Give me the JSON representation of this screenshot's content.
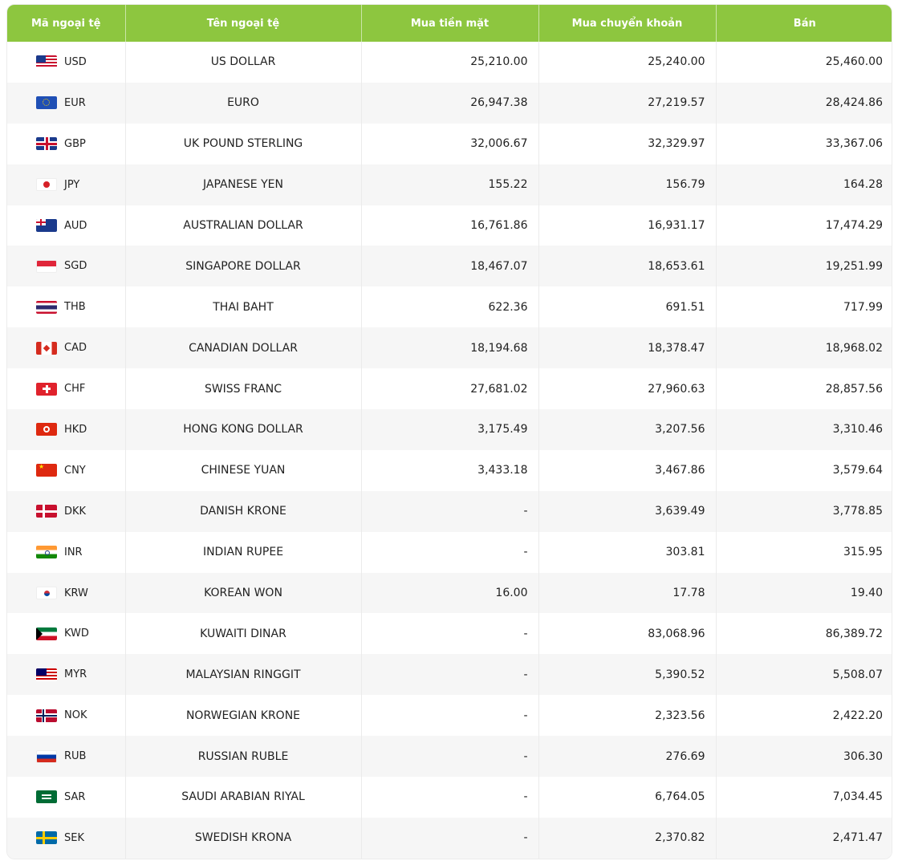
{
  "table": {
    "headers": {
      "code": "Mã ngoại tệ",
      "name": "Tên ngoại tệ",
      "cash_buy": "Mua tiền mặt",
      "transfer_buy": "Mua chuyển khoản",
      "sell": "Bán"
    },
    "rows": [
      {
        "flag": "us-flag-icon",
        "code": "USD",
        "name": "US DOLLAR",
        "cash_buy": "25,210.00",
        "transfer_buy": "25,240.00",
        "sell": "25,460.00"
      },
      {
        "flag": "eu-flag-icon",
        "code": "EUR",
        "name": "EURO",
        "cash_buy": "26,947.38",
        "transfer_buy": "27,219.57",
        "sell": "28,424.86"
      },
      {
        "flag": "uk-flag-icon",
        "code": "GBP",
        "name": "UK POUND STERLING",
        "cash_buy": "32,006.67",
        "transfer_buy": "32,329.97",
        "sell": "33,367.06"
      },
      {
        "flag": "japan-flag-icon",
        "code": "JPY",
        "name": "JAPANESE YEN",
        "cash_buy": "155.22",
        "transfer_buy": "156.79",
        "sell": "164.28"
      },
      {
        "flag": "australia-flag-icon",
        "code": "AUD",
        "name": "AUSTRALIAN DOLLAR",
        "cash_buy": "16,761.86",
        "transfer_buy": "16,931.17",
        "sell": "17,474.29"
      },
      {
        "flag": "singapore-flag-icon",
        "code": "SGD",
        "name": "SINGAPORE DOLLAR",
        "cash_buy": "18,467.07",
        "transfer_buy": "18,653.61",
        "sell": "19,251.99"
      },
      {
        "flag": "thailand-flag-icon",
        "code": "THB",
        "name": "THAI BAHT",
        "cash_buy": "622.36",
        "transfer_buy": "691.51",
        "sell": "717.99"
      },
      {
        "flag": "canada-flag-icon",
        "code": "CAD",
        "name": "CANADIAN DOLLAR",
        "cash_buy": "18,194.68",
        "transfer_buy": "18,378.47",
        "sell": "18,968.02"
      },
      {
        "flag": "switzerland-flag-icon",
        "code": "CHF",
        "name": "SWISS FRANC",
        "cash_buy": "27,681.02",
        "transfer_buy": "27,960.63",
        "sell": "28,857.56"
      },
      {
        "flag": "hongkong-flag-icon",
        "code": "HKD",
        "name": "HONG KONG DOLLAR",
        "cash_buy": "3,175.49",
        "transfer_buy": "3,207.56",
        "sell": "3,310.46"
      },
      {
        "flag": "china-flag-icon",
        "code": "CNY",
        "name": "CHINESE YUAN",
        "cash_buy": "3,433.18",
        "transfer_buy": "3,467.86",
        "sell": "3,579.64"
      },
      {
        "flag": "denmark-flag-icon",
        "code": "DKK",
        "name": "DANISH KRONE",
        "cash_buy": "-",
        "transfer_buy": "3,639.49",
        "sell": "3,778.85"
      },
      {
        "flag": "india-flag-icon",
        "code": "INR",
        "name": "INDIAN RUPEE",
        "cash_buy": "-",
        "transfer_buy": "303.81",
        "sell": "315.95"
      },
      {
        "flag": "korea-flag-icon",
        "code": "KRW",
        "name": "KOREAN WON",
        "cash_buy": "16.00",
        "transfer_buy": "17.78",
        "sell": "19.40"
      },
      {
        "flag": "kuwait-flag-icon",
        "code": "KWD",
        "name": "KUWAITI DINAR",
        "cash_buy": "-",
        "transfer_buy": "83,068.96",
        "sell": "86,389.72"
      },
      {
        "flag": "malaysia-flag-icon",
        "code": "MYR",
        "name": "MALAYSIAN RINGGIT",
        "cash_buy": "-",
        "transfer_buy": "5,390.52",
        "sell": "5,508.07"
      },
      {
        "flag": "norway-flag-icon",
        "code": "NOK",
        "name": "NORWEGIAN KRONE",
        "cash_buy": "-",
        "transfer_buy": "2,323.56",
        "sell": "2,422.20"
      },
      {
        "flag": "russia-flag-icon",
        "code": "RUB",
        "name": "RUSSIAN RUBLE",
        "cash_buy": "-",
        "transfer_buy": "276.69",
        "sell": "306.30"
      },
      {
        "flag": "saudi-flag-icon",
        "code": "SAR",
        "name": "SAUDI ARABIAN RIYAL",
        "cash_buy": "-",
        "transfer_buy": "6,764.05",
        "sell": "7,034.45"
      },
      {
        "flag": "sweden-flag-icon",
        "code": "SEK",
        "name": "SWEDISH KRONA",
        "cash_buy": "-",
        "transfer_buy": "2,370.82",
        "sell": "2,471.47"
      }
    ]
  },
  "colors": {
    "header_bg": "#8dc63f",
    "header_text": "#ffffff",
    "row_alt_bg": "#f6f6f6"
  }
}
